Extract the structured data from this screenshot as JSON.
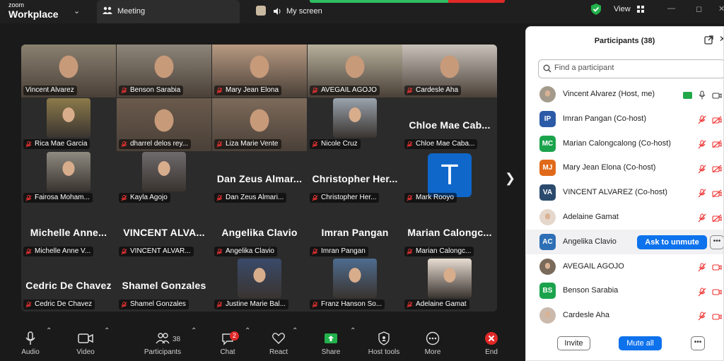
{
  "app": {
    "logo_small": "zoom",
    "logo_big": "Workplace"
  },
  "tabs": {
    "meeting": "Meeting",
    "screen": "My screen"
  },
  "header": {
    "view_label": "View"
  },
  "tiles": [
    {
      "name": "Vincent Alvarez",
      "type": "video",
      "active": true,
      "muted": false,
      "bg": "#8a8070"
    },
    {
      "name": "Benson Sarabia",
      "type": "video",
      "muted": true,
      "bg": "#8d8579"
    },
    {
      "name": "Mary Jean Elona",
      "type": "video",
      "muted": true,
      "bg": "#b89a82"
    },
    {
      "name": "AVEGAIL AGOJO",
      "type": "video",
      "muted": true,
      "bg": "#b7b09c"
    },
    {
      "name": "Cardesle Aha",
      "type": "video",
      "muted": true,
      "bg": "#c9c2ba"
    },
    {
      "name": "Rica Mae Garcia",
      "type": "pic",
      "muted": true,
      "bg": "#8c7a4a"
    },
    {
      "name": "dharrel delos rey...",
      "type": "video",
      "muted": true,
      "bg": "#6a5a4c"
    },
    {
      "name": "Liza Marie Vente",
      "type": "video",
      "muted": true,
      "bg": "#7d6a5a"
    },
    {
      "name": "Nicole Cruz",
      "type": "pic",
      "muted": true,
      "bg": "#9aa3ad"
    },
    {
      "name": "Chloe Mae Caba...",
      "type": "text",
      "big": "Chloe Mae Cab...",
      "muted": true
    },
    {
      "name": "Fairosa Moham...",
      "type": "pic",
      "muted": true,
      "bg": "#8e8a80"
    },
    {
      "name": "Kayla Agojo",
      "type": "pic",
      "muted": true,
      "bg": "#6e6a6c"
    },
    {
      "name": "Dan Zeus Almari...",
      "type": "text",
      "big": "Dan Zeus Almar...",
      "muted": true
    },
    {
      "name": "Christopher Her...",
      "type": "text",
      "big": "Christopher Her...",
      "muted": true
    },
    {
      "name": "Mark Rooyo",
      "type": "avatar",
      "letter": "T",
      "muted": true
    },
    {
      "name": "Michelle Anne V...",
      "type": "text",
      "big": "Michelle Anne...",
      "muted": true
    },
    {
      "name": "VINCENT ALVAR...",
      "type": "text",
      "big": "VINCENT ALVA...",
      "muted": true
    },
    {
      "name": "Angelika Clavio",
      "type": "text",
      "big": "Angelika Clavio",
      "muted": true
    },
    {
      "name": "Imran Pangan",
      "type": "text",
      "big": "Imran Pangan",
      "muted": true
    },
    {
      "name": "Marian Calongc...",
      "type": "text",
      "big": "Marian Calongc...",
      "muted": true
    },
    {
      "name": "Cedric De Chavez",
      "type": "text",
      "big": "Cedric De Chavez",
      "muted": true
    },
    {
      "name": "Shamel Gonzales",
      "type": "text",
      "big": "Shamel Gonzales",
      "muted": true
    },
    {
      "name": "Justine Marie Bal...",
      "type": "pic",
      "muted": true,
      "bg": "#3a4a6a"
    },
    {
      "name": "Franz Hanson So...",
      "type": "pic",
      "muted": true,
      "bg": "#4e6c8e"
    },
    {
      "name": "Adelaine Gamat",
      "type": "pic",
      "muted": true,
      "bg": "#e8ddd2"
    }
  ],
  "toolbar": {
    "audio": "Audio",
    "video": "Video",
    "participants": "Participants",
    "participants_count": "38",
    "chat": "Chat",
    "chat_badge": "2",
    "react": "React",
    "share": "Share",
    "host_tools": "Host tools",
    "more": "More",
    "end": "End"
  },
  "panel": {
    "title": "Participants (38)",
    "search_placeholder": "Find a participant",
    "ask_unmute": "Ask to unmute",
    "invite": "Invite",
    "mute_all": "Mute all",
    "participants": [
      {
        "name": "Vincent Alvarez (Host, me)",
        "initials": "",
        "avatar_color": "#a49a8c",
        "photo": true,
        "sharing": true,
        "mic_on": true,
        "video_off": false
      },
      {
        "name": "Imran Pangan (Co-host)",
        "initials": "IP",
        "avatar_color": "#2b5aa7",
        "mic_on": false,
        "video_off": true
      },
      {
        "name": "Marian Calongcalong (Co-host)",
        "initials": "MC",
        "avatar_color": "#1ba34c",
        "mic_on": false,
        "video_off": true
      },
      {
        "name": "Mary Jean Elona (Co-host)",
        "initials": "MJ",
        "avatar_color": "#e06a1a",
        "mic_on": false,
        "video_off": true
      },
      {
        "name": "VINCENT ALVAREZ (Co-host)",
        "initials": "VA",
        "avatar_color": "#2c4a6e",
        "mic_on": false,
        "video_off": true
      },
      {
        "name": "Adelaine Gamat",
        "initials": "",
        "avatar_color": "#e5d7cc",
        "photo": true,
        "mic_on": false,
        "video_off": true
      },
      {
        "name": "Angelika Clavio",
        "initials": "AC",
        "avatar_color": "#2e6fb5",
        "highlight": true
      },
      {
        "name": "AVEGAIL AGOJO",
        "initials": "",
        "avatar_color": "#7a6a5a",
        "photo": true,
        "mic_on": false,
        "video_off": false
      },
      {
        "name": "Benson Sarabia",
        "initials": "BS",
        "avatar_color": "#1ba34c",
        "mic_on": false,
        "video_off": false
      },
      {
        "name": "Cardesle Aha",
        "initials": "",
        "avatar_color": "#cbb9ac",
        "photo": true,
        "mic_on": false,
        "video_off": false
      }
    ]
  }
}
